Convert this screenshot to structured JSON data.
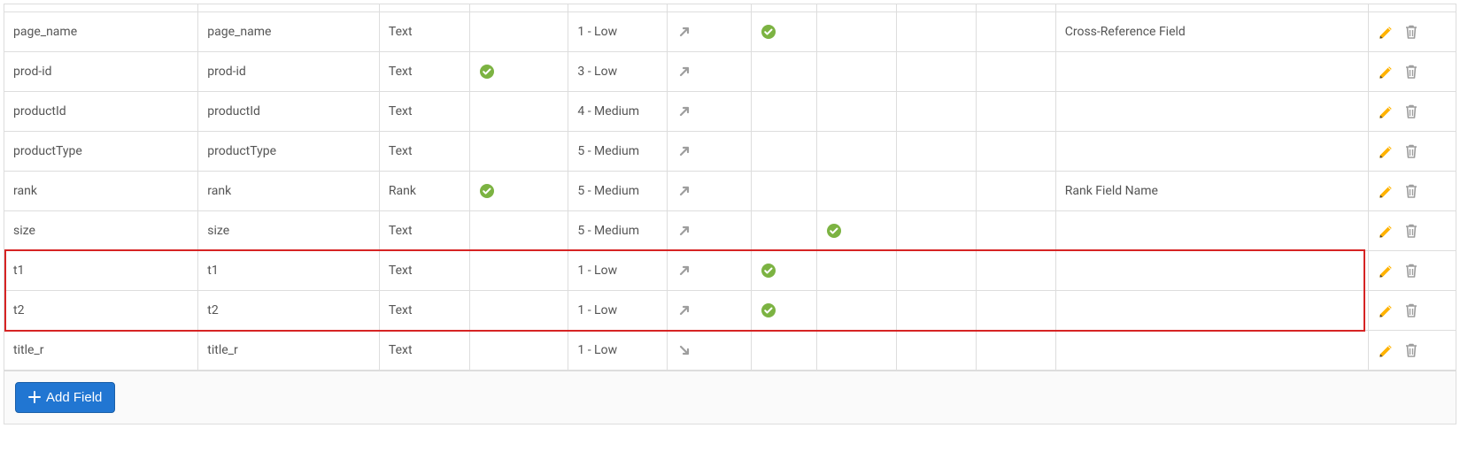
{
  "rows": [
    {
      "name": "page_name",
      "label": "page_name",
      "type": "Text",
      "c4": false,
      "priority": "1 - Low",
      "dir": "up",
      "c7": true,
      "c8": false,
      "c9": false,
      "c10": false,
      "note": "Cross-Reference Field"
    },
    {
      "name": "prod-id",
      "label": "prod-id",
      "type": "Text",
      "c4": true,
      "priority": "3 - Low",
      "dir": "up",
      "c7": false,
      "c8": false,
      "c9": false,
      "c10": false,
      "note": ""
    },
    {
      "name": "productId",
      "label": "productId",
      "type": "Text",
      "c4": false,
      "priority": "4 - Medium",
      "dir": "up",
      "c7": false,
      "c8": false,
      "c9": false,
      "c10": false,
      "note": ""
    },
    {
      "name": "productType",
      "label": "productType",
      "type": "Text",
      "c4": false,
      "priority": "5 - Medium",
      "dir": "up",
      "c7": false,
      "c8": false,
      "c9": false,
      "c10": false,
      "note": ""
    },
    {
      "name": "rank",
      "label": "rank",
      "type": "Rank",
      "c4": true,
      "priority": "5 - Medium",
      "dir": "up",
      "c7": false,
      "c8": false,
      "c9": false,
      "c10": false,
      "note": "Rank Field Name"
    },
    {
      "name": "size",
      "label": "size",
      "type": "Text",
      "c4": false,
      "priority": "5 - Medium",
      "dir": "up",
      "c7": false,
      "c8": true,
      "c9": false,
      "c10": false,
      "note": ""
    },
    {
      "name": "t1",
      "label": "t1",
      "type": "Text",
      "c4": false,
      "priority": "1 - Low",
      "dir": "up",
      "c7": true,
      "c8": false,
      "c9": false,
      "c10": false,
      "note": "",
      "highlight": true
    },
    {
      "name": "t2",
      "label": "t2",
      "type": "Text",
      "c4": false,
      "priority": "1 - Low",
      "dir": "up",
      "c7": true,
      "c8": false,
      "c9": false,
      "c10": false,
      "note": "",
      "highlight": true
    },
    {
      "name": "title_r",
      "label": "title_r",
      "type": "Text",
      "c4": false,
      "priority": "1 - Low",
      "dir": "down",
      "c7": false,
      "c8": false,
      "c9": false,
      "c10": false,
      "note": ""
    }
  ],
  "buttons": {
    "add_field": "Add Field"
  }
}
